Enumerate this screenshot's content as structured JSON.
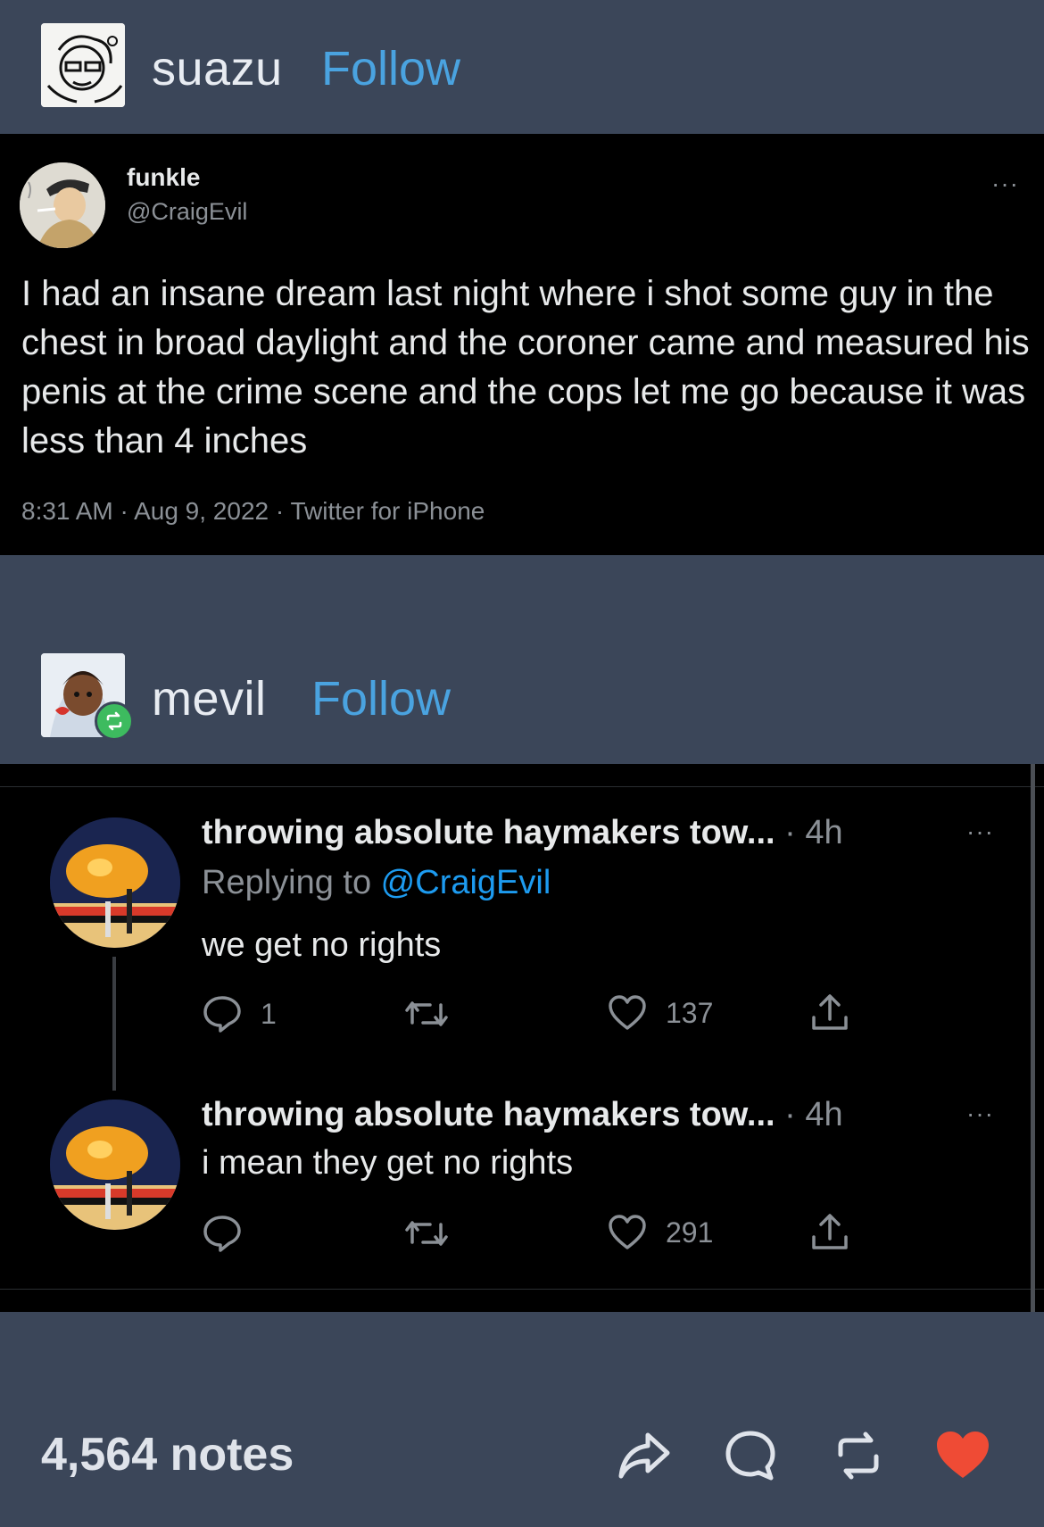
{
  "post1": {
    "username": "suazu",
    "follow_label": "Follow"
  },
  "tweet": {
    "name": "funkle",
    "handle": "@CraigEvil",
    "more": "···",
    "text": "I had an insane dream last night where i shot some guy in the chest in broad daylight and the coroner came and measured his penis at the crime scene and the cops let me go because it was less than 4 inches",
    "meta": "8:31 AM · Aug 9, 2022 · Twitter for iPhone"
  },
  "post2": {
    "username": "mevil",
    "follow_label": "Follow"
  },
  "replies": [
    {
      "name": "throwing absolute haymakers tow...",
      "time": " · 4h",
      "replying_prefix": "Replying to ",
      "replying_mention": "@CraigEvil",
      "text": "we get no rights",
      "reply_count": "1",
      "retweet_count": "",
      "like_count": "137",
      "more": "···"
    },
    {
      "name": "throwing absolute haymakers tow...",
      "time": " · 4h",
      "text": "i mean they get no rights",
      "reply_count": "",
      "retweet_count": "",
      "like_count": "291",
      "more": "···"
    }
  ],
  "footer": {
    "notes": "4,564 notes"
  },
  "colors": {
    "tumblr_bg": "#3b4659",
    "follow_blue": "#4aa3e0",
    "twitter_link": "#1d9bf0",
    "like_red": "#ef4b35",
    "reblog_green": "#3dbb5f"
  }
}
